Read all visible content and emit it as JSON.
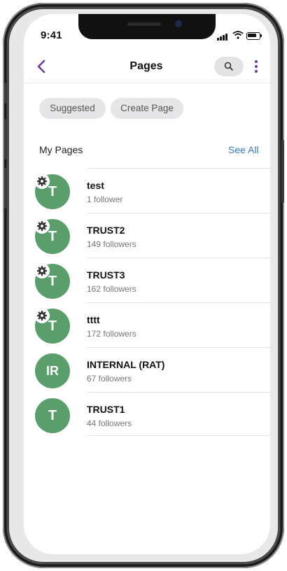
{
  "status": {
    "time": "9:41"
  },
  "header": {
    "title": "Pages"
  },
  "chips": [
    {
      "label": "Suggested"
    },
    {
      "label": "Create Page"
    }
  ],
  "section": {
    "title": "My Pages",
    "see_all": "See All"
  },
  "pages": [
    {
      "initials": "T",
      "name": "test",
      "followers": "1 follower",
      "admin": true
    },
    {
      "initials": "T",
      "name": "TRUST2",
      "followers": "149 followers",
      "admin": true
    },
    {
      "initials": "T",
      "name": "TRUST3",
      "followers": "162 followers",
      "admin": true
    },
    {
      "initials": "T",
      "name": "tttt",
      "followers": "172 followers",
      "admin": true
    },
    {
      "initials": "IR",
      "name": "INTERNAL (RAT)",
      "followers": "67 followers",
      "admin": false
    },
    {
      "initials": "T",
      "name": "TRUST1",
      "followers": "44 followers",
      "admin": false
    }
  ],
  "colors": {
    "accent": "#6b3aa0",
    "link": "#3a7abd",
    "avatar": "#5a9e6c"
  },
  "icons": {
    "back": "chevron-left-icon",
    "search": "search-icon",
    "more": "more-vertical-icon",
    "admin": "gear-icon"
  }
}
